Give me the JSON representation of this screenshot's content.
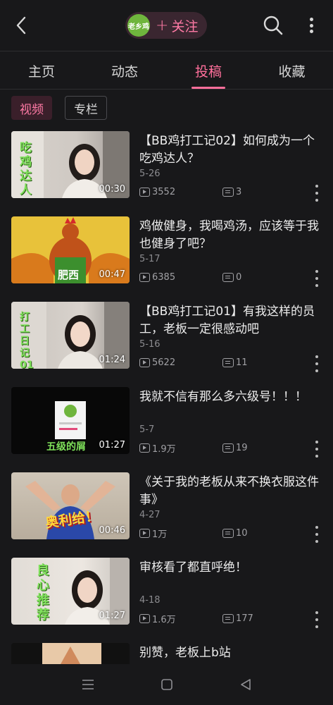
{
  "header": {
    "brand_logo_text": "老乡鸡",
    "follow_label": "关注",
    "follow_plus": "+"
  },
  "tabs": [
    {
      "label": "主页",
      "active": false
    },
    {
      "label": "动态",
      "active": false
    },
    {
      "label": "投稿",
      "active": true
    },
    {
      "label": "收藏",
      "active": false
    }
  ],
  "filters": [
    {
      "label": "视频",
      "active": true
    },
    {
      "label": "专栏",
      "active": false
    }
  ],
  "videos": [
    {
      "title": "【BB鸡打工记02】如何成为一个吃鸡达人？",
      "date": "5-26",
      "views": "3552",
      "comments": "3",
      "duration": "00:30",
      "thumb_text": "吃鸡达人"
    },
    {
      "title": "鸡做健身，我喝鸡汤，应该等于我也健身了吧？",
      "date": "5-17",
      "views": "6385",
      "comments": "0",
      "duration": "00:47",
      "thumb_text": "肥西"
    },
    {
      "title": "【BB鸡打工记01】有我这样的员工，老板一定很感动吧",
      "date": "5-16",
      "views": "5622",
      "comments": "11",
      "duration": "01:24",
      "thumb_text": "打工日记01"
    },
    {
      "title": "我就不信有那么多六级号！！！",
      "date": "5-7",
      "views": "1.9万",
      "comments": "19",
      "duration": "01:27",
      "thumb_text": "五级的屑"
    },
    {
      "title": "《关于我的老板从来不换衣服这件事》",
      "date": "4-27",
      "views": "1万",
      "comments": "10",
      "duration": "00:46",
      "thumb_text": "奥利给！"
    },
    {
      "title": "审核看了都直呼绝！",
      "date": "4-18",
      "views": "1.6万",
      "comments": "177",
      "duration": "01:27",
      "thumb_text": "良心推荐"
    },
    {
      "title": "别赞，老板上b站"
    }
  ],
  "colors": {
    "accent": "#ff6f9b",
    "background": "#18181a",
    "brand_green": "#6fb53d"
  },
  "icons": {
    "back": "chevron-left-icon",
    "search": "search-icon",
    "more": "more-vertical-icon",
    "views": "play-count-icon",
    "comments": "danmaku-icon",
    "nav_menu": "menu-icon",
    "nav_home": "home-square-icon",
    "nav_back": "back-triangle-icon"
  }
}
